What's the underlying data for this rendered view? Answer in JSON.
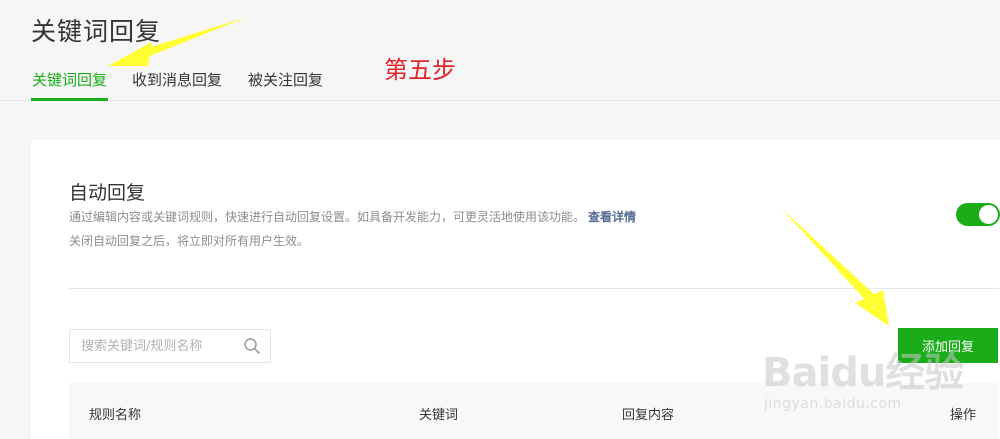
{
  "page": {
    "title": "关键词回复"
  },
  "tabs": [
    {
      "label": "关键词回复",
      "active": true
    },
    {
      "label": "收到消息回复",
      "active": false
    },
    {
      "label": "被关注回复",
      "active": false
    }
  ],
  "annotation": {
    "step_note": "第五步",
    "color": "#e0252b",
    "arrow_color": "#ffff33"
  },
  "auto_reply": {
    "title": "自动回复",
    "description": "通过编辑内容或关键词规则，快速进行自动回复设置。如具备开发能力，可更灵活地使用该功能。",
    "details_link": "查看详情",
    "note": "关闭自动回复之后，将立即对所有用户生效。",
    "enabled": true
  },
  "search": {
    "placeholder": "搜索关键词/规则名称",
    "value": "",
    "icon": "search-icon"
  },
  "actions": {
    "add_reply_label": "添加回复"
  },
  "table": {
    "columns": [
      "规则名称",
      "关键词",
      "回复内容",
      "操作"
    ]
  },
  "watermark": {
    "logo": "Baidu经验",
    "url": "jingyan.baidu.com"
  },
  "colors": {
    "accent": "#1aad19",
    "link": "#576b95",
    "text": "#353535",
    "muted": "#8d8d8d"
  }
}
